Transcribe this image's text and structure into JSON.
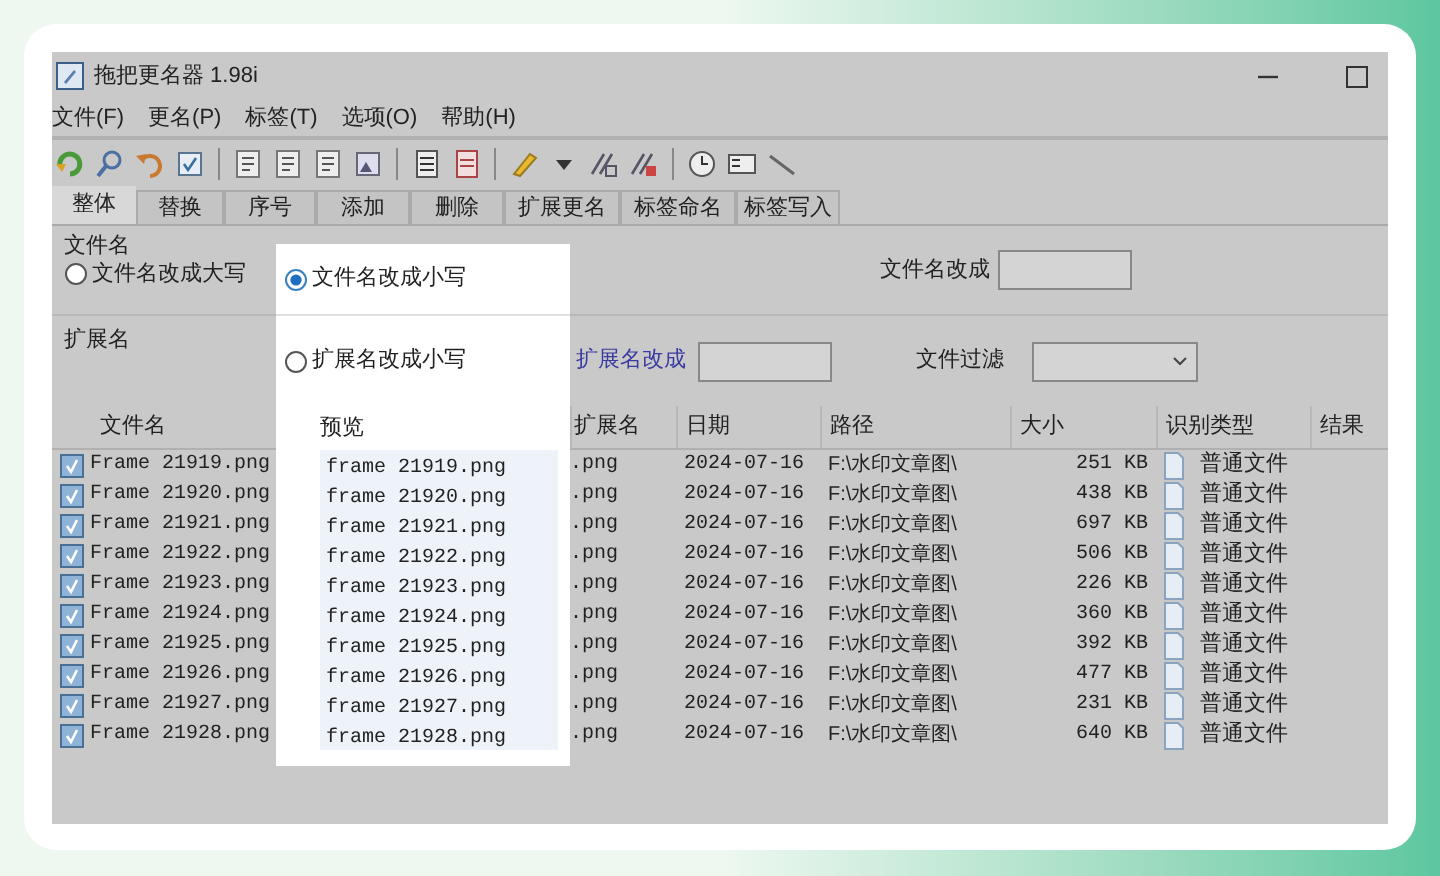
{
  "window": {
    "title": "拖把更名器 1.98i"
  },
  "menu": [
    "文件(F)",
    "更名(P)",
    "标签(T)",
    "选项(O)",
    "帮助(H)"
  ],
  "tabs": [
    {
      "label": "整体",
      "selected": true
    },
    {
      "label": "替换",
      "selected": false
    },
    {
      "label": "序号",
      "selected": false
    },
    {
      "label": "添加",
      "selected": false
    },
    {
      "label": "删除",
      "selected": false
    },
    {
      "label": "扩展更名",
      "selected": false
    },
    {
      "label": "标签命名",
      "selected": false
    },
    {
      "label": "标签写入",
      "selected": false
    }
  ],
  "options": {
    "filename_group": "文件名",
    "upper_radio": {
      "label": "文件名改成大写",
      "selected": false
    },
    "lower_radio": {
      "label": "文件名改成小写",
      "selected": true
    },
    "filename_change_label": "文件名改成",
    "ext_group": "扩展名",
    "ext_lower_radio": {
      "label": "扩展名改成小写",
      "selected": false
    },
    "ext_change_label": "扩展名改成",
    "filter_label": "文件过滤"
  },
  "table": {
    "columns": [
      "文件名",
      "预览",
      "扩展名",
      "日期",
      "路径",
      "大小",
      "识别类型",
      "结果"
    ],
    "rows": [
      {
        "checked": true,
        "name": "Frame 21919.png",
        "preview": "frame 21919.png",
        "ext": ".png",
        "date": "2024-07-16",
        "path": "F:\\水印文章图\\",
        "size": "251 KB",
        "type": "普通文件"
      },
      {
        "checked": true,
        "name": "Frame 21920.png",
        "preview": "frame 21920.png",
        "ext": ".png",
        "date": "2024-07-16",
        "path": "F:\\水印文章图\\",
        "size": "438 KB",
        "type": "普通文件"
      },
      {
        "checked": true,
        "name": "Frame 21921.png",
        "preview": "frame 21921.png",
        "ext": ".png",
        "date": "2024-07-16",
        "path": "F:\\水印文章图\\",
        "size": "697 KB",
        "type": "普通文件"
      },
      {
        "checked": true,
        "name": "Frame 21922.png",
        "preview": "frame 21922.png",
        "ext": ".png",
        "date": "2024-07-16",
        "path": "F:\\水印文章图\\",
        "size": "506 KB",
        "type": "普通文件"
      },
      {
        "checked": true,
        "name": "Frame 21923.png",
        "preview": "frame 21923.png",
        "ext": ".png",
        "date": "2024-07-16",
        "path": "F:\\水印文章图\\",
        "size": "226 KB",
        "type": "普通文件"
      },
      {
        "checked": true,
        "name": "Frame 21924.png",
        "preview": "frame 21924.png",
        "ext": ".png",
        "date": "2024-07-16",
        "path": "F:\\水印文章图\\",
        "size": "360 KB",
        "type": "普通文件"
      },
      {
        "checked": true,
        "name": "Frame 21925.png",
        "preview": "frame 21925.png",
        "ext": ".png",
        "date": "2024-07-16",
        "path": "F:\\水印文章图\\",
        "size": "392 KB",
        "type": "普通文件"
      },
      {
        "checked": true,
        "name": "Frame 21926.png",
        "preview": "frame 21926.png",
        "ext": ".png",
        "date": "2024-07-16",
        "path": "F:\\水印文章图\\",
        "size": "477 KB",
        "type": "普通文件"
      },
      {
        "checked": true,
        "name": "Frame 21927.png",
        "preview": "frame 21927.png",
        "ext": ".png",
        "date": "2024-07-16",
        "path": "F:\\水印文章图\\",
        "size": "231 KB",
        "type": "普通文件"
      },
      {
        "checked": true,
        "name": "Frame 21928.png",
        "preview": "frame 21928.png",
        "ext": ".png",
        "date": "2024-07-16",
        "path": "F:\\水印文章图\\",
        "size": "640 KB",
        "type": "普通文件"
      }
    ]
  }
}
